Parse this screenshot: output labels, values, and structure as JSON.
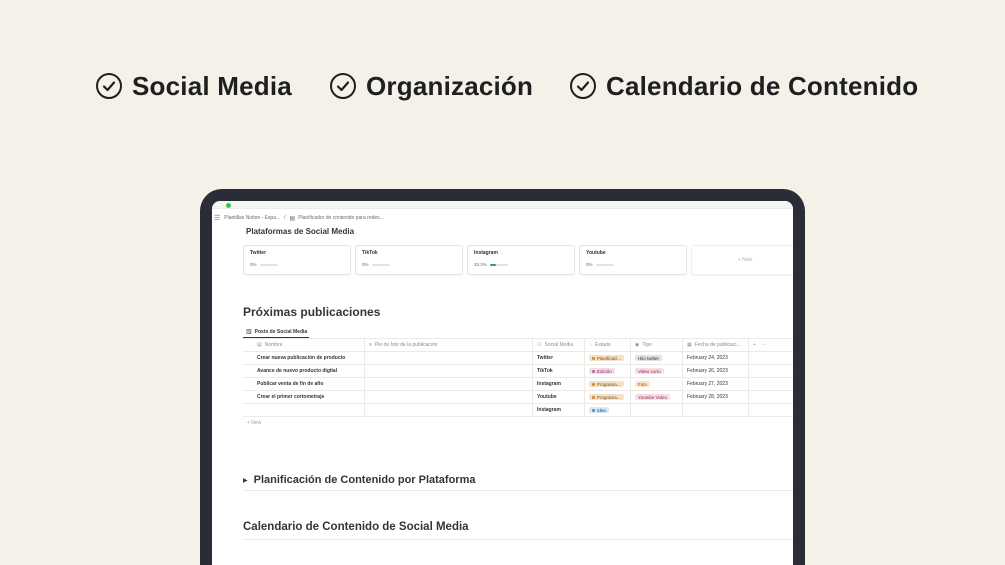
{
  "features": [
    {
      "label": "Social Media"
    },
    {
      "label": "Organización"
    },
    {
      "label": "Calendario de Contenido"
    }
  ],
  "breadcrumb": {
    "items": [
      "Plantillas Notion - Espa...",
      "Planificador de contenido para redes..."
    ]
  },
  "platforms": {
    "title": "Plataformas de Social Media",
    "cards": [
      {
        "name": "Twitter",
        "progress_label": "0%",
        "progress": 0
      },
      {
        "name": "TikTok",
        "progress_label": "0%",
        "progress": 0
      },
      {
        "name": "Instagram",
        "progress_label": "33.3%",
        "progress": 0.333
      },
      {
        "name": "Youtube",
        "progress_label": "0%",
        "progress": 0
      }
    ],
    "new_label": "+ New"
  },
  "upcoming": {
    "title": "Próximas publicaciones",
    "view_tab": "Posts de Social Media",
    "columns": {
      "name": "Nombre",
      "caption": "Pie de foto de la publicación",
      "social": "Social Media",
      "status": "Estado",
      "type": "Tipo",
      "date": "Fecha de publicaci..."
    },
    "rows": [
      {
        "name": "Crear nueva publicación de producto",
        "social": "Twitter",
        "status": "Planificaci...",
        "type": "Hilo twitter",
        "date": "February 24, 2023"
      },
      {
        "name": "Avance de nuevo producto digital",
        "social": "TikTok",
        "status": "Edición",
        "type": "Video corto",
        "date": "February 26, 2023"
      },
      {
        "name": "Publicar venta de fin de año",
        "social": "Instagram",
        "status": "Programa...",
        "type": "Foto",
        "date": "February 27, 2023"
      },
      {
        "name": "Crear el primer cortometraje",
        "social": "Youtube",
        "status": "Programa...",
        "type": "Youtube Video",
        "date": "February 28, 2023"
      },
      {
        "name": "",
        "social": "Instagram",
        "status": "Idea",
        "type": "",
        "date": ""
      }
    ],
    "new_label": "+ New"
  },
  "planning_toggle": "Planificación de Contenido por Plataforma",
  "calendar": {
    "title": "Calendario de Contenido de Social Media"
  },
  "colors": {
    "background": "#f4f1e9",
    "device": "#2a2d35",
    "progress_fill": "#2f9e6f",
    "status_orange": "#f5e0c8",
    "status_pink": "#f5dcea",
    "status_blue": "#d8e8f5",
    "type_gray": "#e3e2e0",
    "type_orange": "#fbe4c8",
    "type_pink": "#f8dde6"
  }
}
